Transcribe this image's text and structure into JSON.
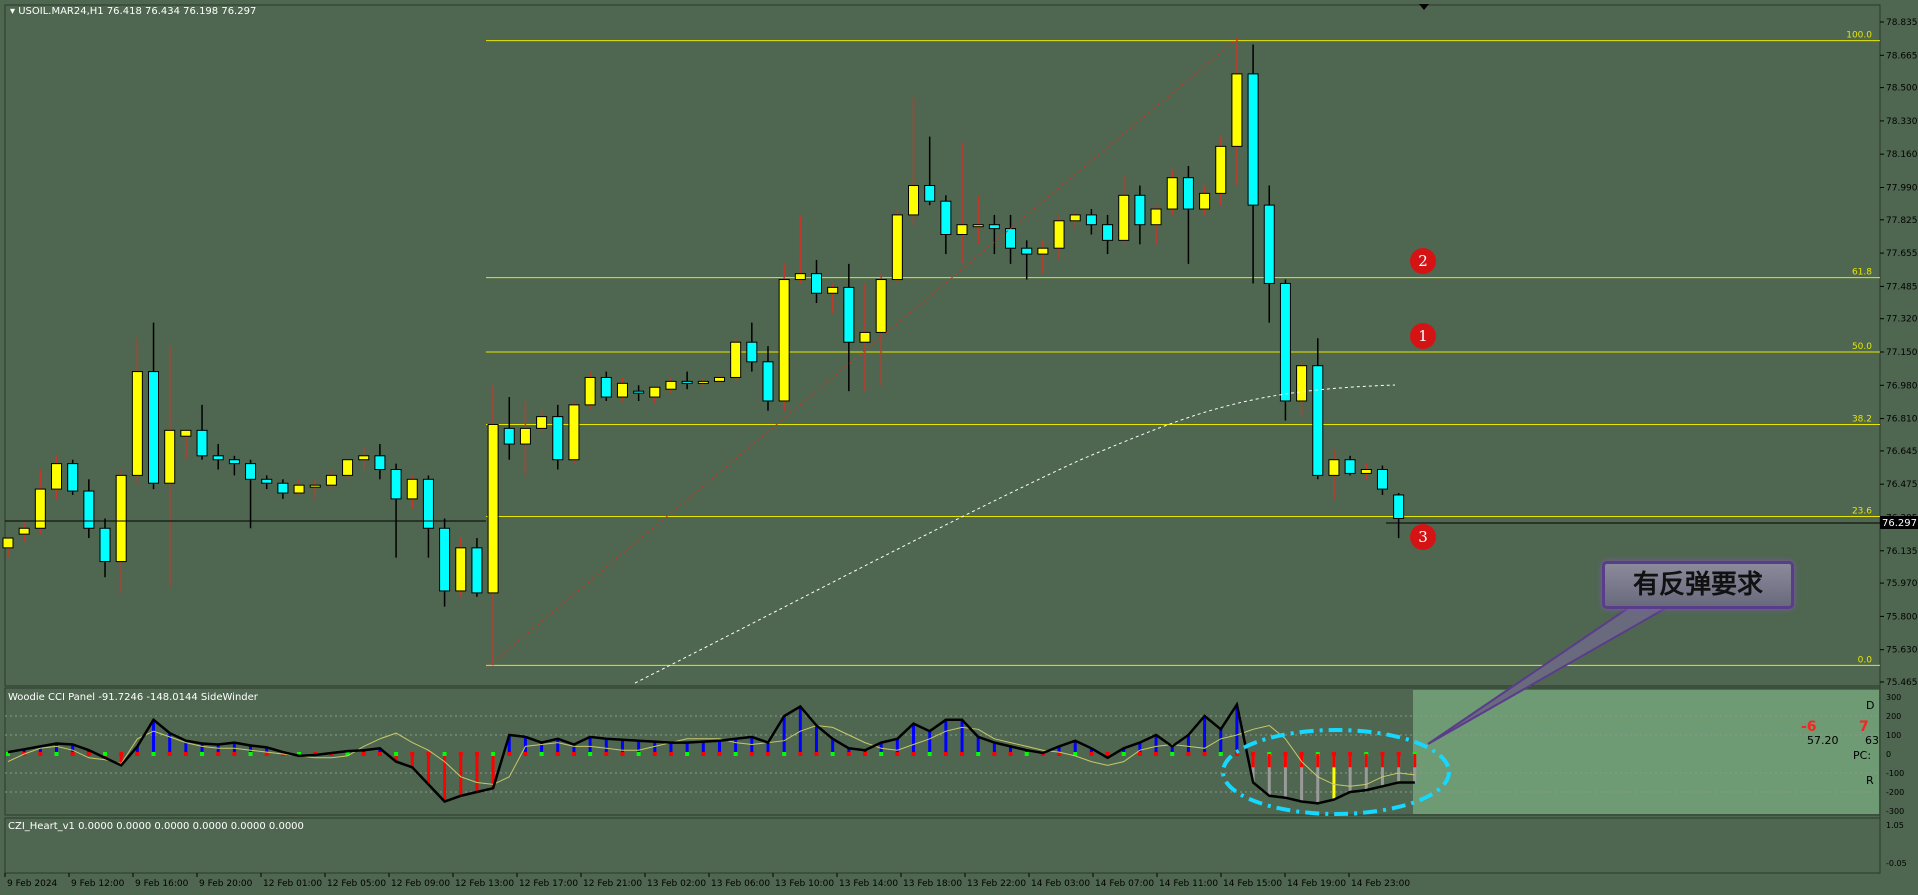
{
  "chart_header": {
    "symbol_line": "USOIL.MAR24,H1  76.418 76.434 76.198 76.297"
  },
  "colors": {
    "background": "#4f6750",
    "bull_candle": "#ffff00",
    "bear_candle": "#00ffff",
    "wick": "#c0392b",
    "fib_line": "#e6e600",
    "cci_blue": "#0000ff",
    "cci_red": "#ff0000",
    "cci_line": "#000000",
    "highlight_area": "#6e9a74",
    "marker": "#d41414",
    "ellipse": "#16d8ff"
  },
  "price_axis": {
    "ticks": [
      "78.835",
      "78.665",
      "78.500",
      "78.330",
      "78.160",
      "77.990",
      "77.825",
      "77.655",
      "77.485",
      "77.320",
      "77.150",
      "76.980",
      "76.810",
      "76.645",
      "76.475",
      "76.305",
      "76.135",
      "75.970",
      "75.800",
      "75.630",
      "75.465"
    ],
    "current_price": "76.297"
  },
  "fib_levels": [
    {
      "label": "100.0",
      "price": 78.74
    },
    {
      "label": "61.8",
      "price": 77.53
    },
    {
      "label": "50.0",
      "price": 77.15
    },
    {
      "label": "38.2",
      "price": 76.78
    },
    {
      "label": "23.6",
      "price": 76.31
    },
    {
      "label": "0.0",
      "price": 75.55
    }
  ],
  "markers": [
    "2",
    "1",
    "3"
  ],
  "callout_text": "有反弹要求",
  "cci_panel": {
    "title": "Woodie CCI Panel -91.7246 -148.0144  SideWinder",
    "axis_ticks": [
      "300",
      "200",
      "100",
      "0",
      "-100",
      "-200",
      "-300"
    ],
    "right_labels": [
      "D",
      "PC:",
      "R"
    ],
    "stat_neg": "-6",
    "stat_pos": "7",
    "stat_value": "57.20",
    "stat_small": "63"
  },
  "czi_panel": {
    "title": "CZI_Heart_v1 0.0000 0.0000 0.0000 0.0000 0.0000 0.0000",
    "axis_ticks": [
      "1.05",
      "-0.05"
    ]
  },
  "time_axis": [
    "9 Feb 2024",
    "9 Feb 12:00",
    "9 Feb 16:00",
    "9 Feb 20:00",
    "12 Feb 01:00",
    "12 Feb 05:00",
    "12 Feb 09:00",
    "12 Feb 13:00",
    "12 Feb 17:00",
    "12 Feb 21:00",
    "13 Feb 02:00",
    "13 Feb 06:00",
    "13 Feb 10:00",
    "13 Feb 14:00",
    "13 Feb 18:00",
    "13 Feb 22:00",
    "14 Feb 03:00",
    "14 Feb 07:00",
    "14 Feb 11:00",
    "14 Feb 15:00",
    "14 Feb 19:00",
    "14 Feb 23:00"
  ],
  "chart_data": {
    "type": "candlestick",
    "candles": [
      {
        "o": 76.15,
        "h": 76.2,
        "l": 76.1,
        "c": 76.2
      },
      {
        "o": 76.22,
        "h": 76.28,
        "l": 76.18,
        "c": 76.25
      },
      {
        "o": 76.25,
        "h": 76.55,
        "l": 76.22,
        "c": 76.45
      },
      {
        "o": 76.45,
        "h": 76.62,
        "l": 76.4,
        "c": 76.58
      },
      {
        "o": 76.58,
        "h": 76.6,
        "l": 76.42,
        "c": 76.44
      },
      {
        "o": 76.44,
        "h": 76.5,
        "l": 76.2,
        "c": 76.25
      },
      {
        "o": 76.25,
        "h": 76.3,
        "l": 76.0,
        "c": 76.08
      },
      {
        "o": 76.08,
        "h": 76.55,
        "l": 75.92,
        "c": 76.52
      },
      {
        "o": 76.52,
        "h": 77.22,
        "l": 76.48,
        "c": 77.05
      },
      {
        "o": 77.05,
        "h": 77.3,
        "l": 76.45,
        "c": 76.48
      },
      {
        "o": 76.48,
        "h": 77.18,
        "l": 75.95,
        "c": 76.75
      },
      {
        "o": 76.72,
        "h": 76.75,
        "l": 76.6,
        "c": 76.75
      },
      {
        "o": 76.75,
        "h": 76.88,
        "l": 76.6,
        "c": 76.62
      },
      {
        "o": 76.62,
        "h": 76.68,
        "l": 76.55,
        "c": 76.6
      },
      {
        "o": 76.6,
        "h": 76.62,
        "l": 76.52,
        "c": 76.58
      },
      {
        "o": 76.58,
        "h": 76.6,
        "l": 76.25,
        "c": 76.5
      },
      {
        "o": 76.5,
        "h": 76.52,
        "l": 76.45,
        "c": 76.48
      },
      {
        "o": 76.48,
        "h": 76.5,
        "l": 76.4,
        "c": 76.43
      },
      {
        "o": 76.43,
        "h": 76.5,
        "l": 76.42,
        "c": 76.47
      },
      {
        "o": 76.46,
        "h": 76.5,
        "l": 76.4,
        "c": 76.47
      },
      {
        "o": 76.47,
        "h": 76.55,
        "l": 76.45,
        "c": 76.52
      },
      {
        "o": 76.52,
        "h": 76.6,
        "l": 76.5,
        "c": 76.6
      },
      {
        "o": 76.6,
        "h": 76.66,
        "l": 76.55,
        "c": 76.62
      },
      {
        "o": 76.62,
        "h": 76.68,
        "l": 76.5,
        "c": 76.55
      },
      {
        "o": 76.55,
        "h": 76.58,
        "l": 76.1,
        "c": 76.4
      },
      {
        "o": 76.4,
        "h": 76.52,
        "l": 76.35,
        "c": 76.5
      },
      {
        "o": 76.5,
        "h": 76.52,
        "l": 76.1,
        "c": 76.25
      },
      {
        "o": 76.25,
        "h": 76.3,
        "l": 75.85,
        "c": 75.93
      },
      {
        "o": 75.93,
        "h": 76.2,
        "l": 75.9,
        "c": 76.15
      },
      {
        "o": 76.15,
        "h": 76.2,
        "l": 75.9,
        "c": 75.92
      },
      {
        "o": 75.92,
        "h": 76.98,
        "l": 75.55,
        "c": 76.78
      },
      {
        "o": 76.76,
        "h": 76.92,
        "l": 76.6,
        "c": 76.68
      },
      {
        "o": 76.68,
        "h": 76.9,
        "l": 76.52,
        "c": 76.76
      },
      {
        "o": 76.76,
        "h": 76.85,
        "l": 76.74,
        "c": 76.82
      },
      {
        "o": 76.82,
        "h": 76.88,
        "l": 76.55,
        "c": 76.6
      },
      {
        "o": 76.6,
        "h": 76.9,
        "l": 76.58,
        "c": 76.88
      },
      {
        "o": 76.88,
        "h": 77.05,
        "l": 76.86,
        "c": 77.02
      },
      {
        "o": 77.02,
        "h": 77.05,
        "l": 76.9,
        "c": 76.92
      },
      {
        "o": 76.92,
        "h": 77.02,
        "l": 76.9,
        "c": 76.99
      },
      {
        "o": 76.95,
        "h": 76.98,
        "l": 76.9,
        "c": 76.94
      },
      {
        "o": 76.92,
        "h": 76.97,
        "l": 76.89,
        "c": 76.97
      },
      {
        "o": 76.96,
        "h": 77.02,
        "l": 76.94,
        "c": 77.0
      },
      {
        "o": 77.0,
        "h": 77.05,
        "l": 76.96,
        "c": 76.99
      },
      {
        "o": 76.99,
        "h": 77.02,
        "l": 76.97,
        "c": 77.0
      },
      {
        "o": 77.0,
        "h": 77.04,
        "l": 76.99,
        "c": 77.02
      },
      {
        "o": 77.02,
        "h": 77.22,
        "l": 77.0,
        "c": 77.2
      },
      {
        "o": 77.2,
        "h": 77.3,
        "l": 77.05,
        "c": 77.1
      },
      {
        "o": 77.1,
        "h": 77.18,
        "l": 76.85,
        "c": 76.9
      },
      {
        "o": 76.9,
        "h": 77.6,
        "l": 76.85,
        "c": 77.52
      },
      {
        "o": 77.52,
        "h": 77.85,
        "l": 77.5,
        "c": 77.55
      },
      {
        "o": 77.55,
        "h": 77.62,
        "l": 77.4,
        "c": 77.45
      },
      {
        "o": 77.45,
        "h": 77.5,
        "l": 77.35,
        "c": 77.48
      },
      {
        "o": 77.48,
        "h": 77.6,
        "l": 76.95,
        "c": 77.2
      },
      {
        "o": 77.2,
        "h": 77.5,
        "l": 76.95,
        "c": 77.25
      },
      {
        "o": 77.25,
        "h": 77.55,
        "l": 76.98,
        "c": 77.52
      },
      {
        "o": 77.52,
        "h": 77.88,
        "l": 77.5,
        "c": 77.85
      },
      {
        "o": 77.85,
        "h": 78.45,
        "l": 77.8,
        "c": 78.0
      },
      {
        "o": 78.0,
        "h": 78.25,
        "l": 77.9,
        "c": 77.92
      },
      {
        "o": 77.92,
        "h": 77.95,
        "l": 77.65,
        "c": 77.75
      },
      {
        "o": 77.75,
        "h": 78.22,
        "l": 77.6,
        "c": 77.8
      },
      {
        "o": 77.8,
        "h": 77.95,
        "l": 77.7,
        "c": 77.8
      },
      {
        "o": 77.8,
        "h": 77.85,
        "l": 77.65,
        "c": 77.78
      },
      {
        "o": 77.78,
        "h": 77.85,
        "l": 77.6,
        "c": 77.68
      },
      {
        "o": 77.68,
        "h": 77.72,
        "l": 77.52,
        "c": 77.65
      },
      {
        "o": 77.65,
        "h": 77.72,
        "l": 77.55,
        "c": 77.68
      },
      {
        "o": 77.68,
        "h": 77.85,
        "l": 77.62,
        "c": 77.82
      },
      {
        "o": 77.82,
        "h": 77.87,
        "l": 77.78,
        "c": 77.85
      },
      {
        "o": 77.85,
        "h": 77.88,
        "l": 77.75,
        "c": 77.8
      },
      {
        "o": 77.8,
        "h": 77.85,
        "l": 77.65,
        "c": 77.72
      },
      {
        "o": 77.72,
        "h": 78.05,
        "l": 77.7,
        "c": 77.95
      },
      {
        "o": 77.95,
        "h": 78.0,
        "l": 77.7,
        "c": 77.8
      },
      {
        "o": 77.8,
        "h": 77.9,
        "l": 77.7,
        "c": 77.88
      },
      {
        "o": 77.88,
        "h": 78.08,
        "l": 77.85,
        "c": 78.04
      },
      {
        "o": 78.04,
        "h": 78.1,
        "l": 77.6,
        "c": 77.88
      },
      {
        "o": 77.88,
        "h": 78.0,
        "l": 77.85,
        "c": 77.96
      },
      {
        "o": 77.96,
        "h": 78.25,
        "l": 77.9,
        "c": 78.2
      },
      {
        "o": 78.2,
        "h": 78.76,
        "l": 78.0,
        "c": 78.57
      },
      {
        "o": 78.57,
        "h": 78.72,
        "l": 77.5,
        "c": 77.9
      },
      {
        "o": 77.9,
        "h": 78.0,
        "l": 77.3,
        "c": 77.5
      },
      {
        "o": 77.5,
        "h": 77.52,
        "l": 76.8,
        "c": 76.9
      },
      {
        "o": 76.9,
        "h": 77.1,
        "l": 76.82,
        "c": 77.08
      },
      {
        "o": 77.08,
        "h": 77.22,
        "l": 76.5,
        "c": 76.52
      },
      {
        "o": 76.52,
        "h": 76.65,
        "l": 76.4,
        "c": 76.6
      },
      {
        "o": 76.6,
        "h": 76.62,
        "l": 76.52,
        "c": 76.53
      },
      {
        "o": 76.53,
        "h": 76.58,
        "l": 76.5,
        "c": 76.55
      },
      {
        "o": 76.55,
        "h": 76.57,
        "l": 76.42,
        "c": 76.45
      },
      {
        "o": 76.42,
        "h": 76.43,
        "l": 76.2,
        "c": 76.3
      }
    ],
    "cci": [
      10,
      25,
      40,
      55,
      50,
      20,
      -20,
      -60,
      40,
      180,
      110,
      70,
      55,
      50,
      60,
      45,
      35,
      10,
      -10,
      -5,
      5,
      15,
      20,
      30,
      -40,
      -70,
      -160,
      -250,
      -220,
      -200,
      -180,
      100,
      90,
      60,
      80,
      50,
      90,
      80,
      75,
      70,
      65,
      60,
      60,
      65,
      70,
      80,
      90,
      60,
      200,
      250,
      150,
      80,
      30,
      20,
      60,
      80,
      160,
      120,
      180,
      180,
      90,
      60,
      40,
      20,
      5,
      40,
      70,
      30,
      -20,
      30,
      60,
      100,
      40,
      100,
      200,
      130,
      260,
      -150,
      -220,
      -230,
      -250,
      -260,
      -240,
      -200,
      -190,
      -170,
      -150,
      -150
    ],
    "cci_signal": [
      -40,
      0,
      30,
      40,
      20,
      -20,
      -30,
      -50,
      80,
      120,
      90,
      60,
      40,
      30,
      30,
      20,
      10,
      0,
      -10,
      -20,
      -20,
      -10,
      40,
      80,
      110,
      60,
      20,
      -40,
      -120,
      -150,
      -160,
      -120,
      40,
      50,
      60,
      40,
      40,
      30,
      20,
      20,
      40,
      60,
      80,
      80,
      80,
      60,
      50,
      60,
      70,
      120,
      150,
      140,
      100,
      60,
      30,
      20,
      50,
      80,
      120,
      140,
      130,
      80,
      60,
      40,
      20,
      10,
      -10,
      -40,
      -60,
      -40,
      20,
      40,
      50,
      40,
      30,
      80,
      100,
      130,
      150,
      80,
      -40,
      -120,
      -160,
      -170,
      -160,
      -120,
      -100,
      -110
    ]
  }
}
